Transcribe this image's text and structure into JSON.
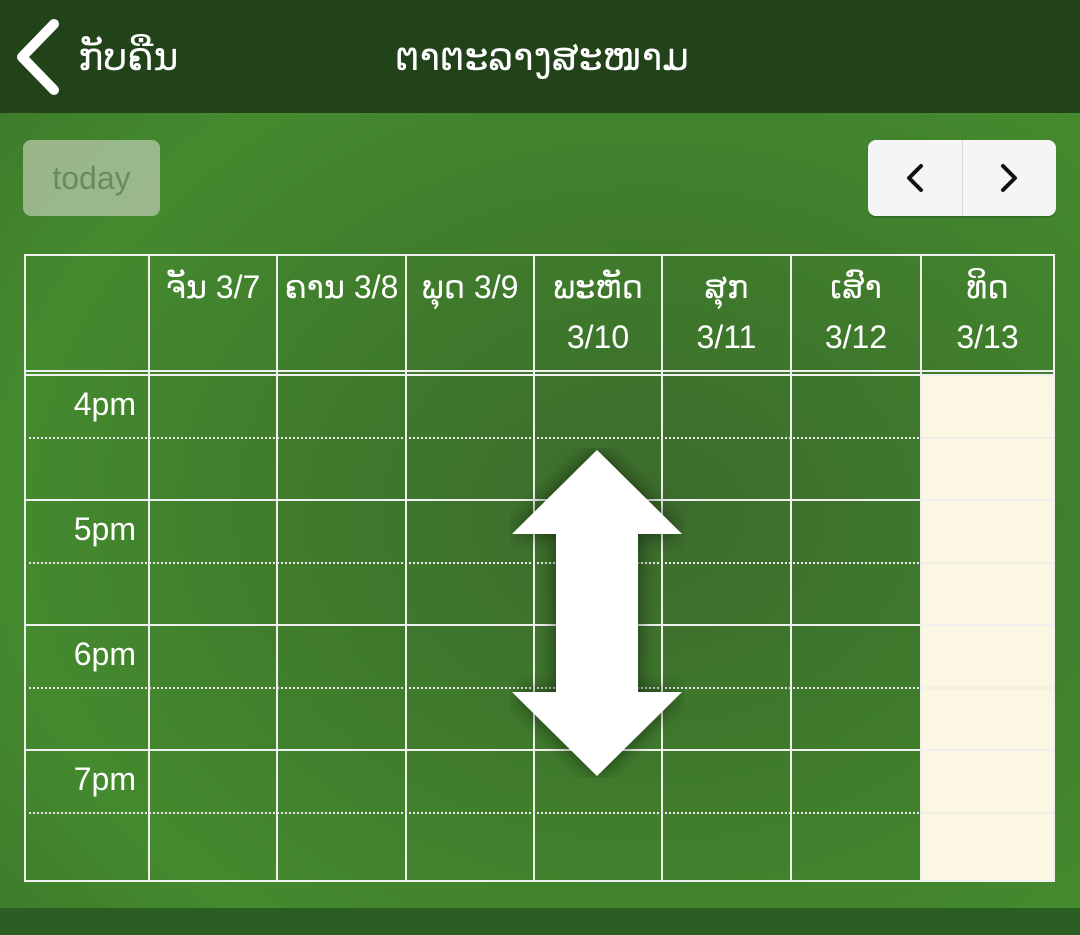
{
  "header": {
    "back_label": "ກັບຄືນ",
    "title": "ຕາຕະລາງສະໜາມ"
  },
  "toolbar": {
    "today_label": "today",
    "prev_icon": "chevron-left-icon",
    "next_icon": "chevron-right-icon"
  },
  "calendar": {
    "days": [
      {
        "line1": "ຈັນ 3/7",
        "line2": ""
      },
      {
        "line1": "ຄານ 3/8",
        "line2": ""
      },
      {
        "line1": "ພຸດ 3/9",
        "line2": ""
      },
      {
        "line1": "ພະຫັດ",
        "line2": "3/10"
      },
      {
        "line1": "ສຸກ",
        "line2": "3/11"
      },
      {
        "line1": "ເສົາ",
        "line2": "3/12"
      },
      {
        "line1": "ທິດ",
        "line2": "3/13"
      }
    ],
    "times": [
      "4pm",
      "5pm",
      "6pm",
      "7pm"
    ],
    "today_highlight_color": "#fcf7e3"
  },
  "overlay": {
    "icon": "vertical-double-arrow-icon"
  }
}
